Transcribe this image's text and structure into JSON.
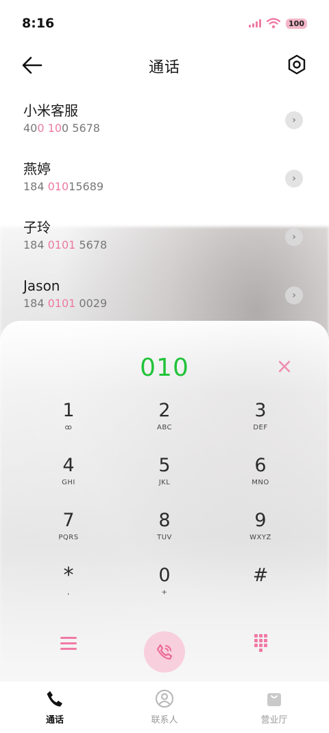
{
  "status_bar": {
    "time": "8:16",
    "battery": "100"
  },
  "header": {
    "title": "通话"
  },
  "contacts": [
    {
      "name": "小米客服",
      "number_parts": [
        "40",
        "0",
        " ",
        "10",
        "0 5678"
      ]
    },
    {
      "name": "燕婷",
      "number_parts": [
        "184 ",
        "010",
        "",
        "",
        "15689"
      ]
    },
    {
      "name": "子玲",
      "number_parts": [
        "184 ",
        "0101",
        "",
        "",
        " 5678"
      ]
    },
    {
      "name": "Jason",
      "number_parts": [
        "184 ",
        "0101",
        "",
        "",
        " 0029"
      ]
    }
  ],
  "dialer": {
    "input": "010",
    "keys": [
      {
        "digit": "1",
        "letters": "ꝏ"
      },
      {
        "digit": "2",
        "letters": "ABC"
      },
      {
        "digit": "3",
        "letters": "DEF"
      },
      {
        "digit": "4",
        "letters": "GHI"
      },
      {
        "digit": "5",
        "letters": "JKL"
      },
      {
        "digit": "6",
        "letters": "MNO"
      },
      {
        "digit": "7",
        "letters": "PQRS"
      },
      {
        "digit": "8",
        "letters": "TUV"
      },
      {
        "digit": "9",
        "letters": "WXYZ"
      },
      {
        "digit": "*",
        "letters": ","
      },
      {
        "digit": "0",
        "letters": "+"
      },
      {
        "digit": "#",
        "letters": ""
      }
    ]
  },
  "bottom_nav": [
    {
      "label": "通话",
      "icon": "phone-icon",
      "active": true
    },
    {
      "label": "联系人",
      "icon": "person-icon",
      "active": false
    },
    {
      "label": "营业厅",
      "icon": "bag-icon",
      "active": false
    }
  ],
  "colors": {
    "accent": "#f07aa5",
    "dial_text": "#22c33a",
    "highlight": "#ec7aa2"
  }
}
